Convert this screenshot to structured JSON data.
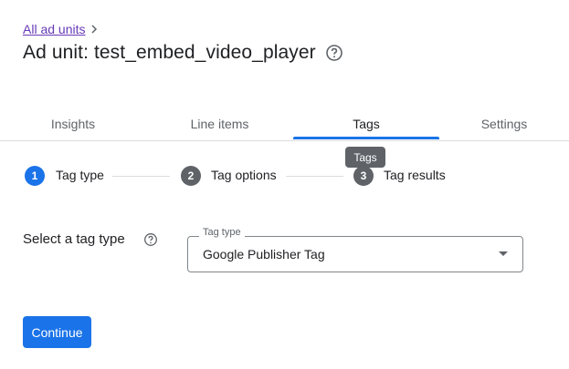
{
  "breadcrumb": {
    "link_label": "All ad units"
  },
  "page": {
    "title": "Ad unit: test_embed_video_player"
  },
  "tabs": [
    {
      "label": "Insights"
    },
    {
      "label": "Line items"
    },
    {
      "label": "Tags",
      "active": true
    },
    {
      "label": "Settings"
    }
  ],
  "tooltip": {
    "text": "Tags"
  },
  "stepper": {
    "steps": [
      {
        "number": "1",
        "label": "Tag type",
        "state": "active"
      },
      {
        "number": "2",
        "label": "Tag options",
        "state": "pending"
      },
      {
        "number": "3",
        "label": "Tag results",
        "state": "pending"
      }
    ]
  },
  "form": {
    "label": "Select a tag type",
    "select_legend": "Tag type",
    "select_value": "Google Publisher Tag"
  },
  "actions": {
    "continue_label": "Continue"
  },
  "colors": {
    "accent": "#1a73e8",
    "link": "#673ab7",
    "step_inactive": "#5f6368",
    "tooltip_bg": "#5f6368"
  }
}
